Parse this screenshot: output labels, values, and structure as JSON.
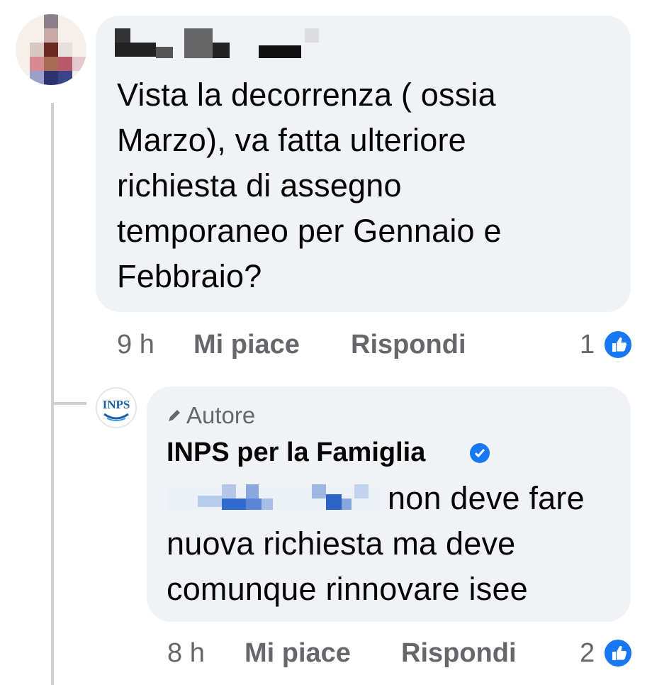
{
  "comment": {
    "text": "Vista la decorrenza ( ossia Marzo), va fatta ulteriore richiesta di assegno temporaneo per Gennaio e Febbraio?",
    "lines": [
      "Vista la decorrenza ( ossia",
      "Marzo), va fatta ulteriore",
      "richiesta di assegno",
      "temporaneo per Gennaio e",
      "Febbraio?"
    ],
    "time": "9 h",
    "like_label": "Mi piace",
    "reply_label": "Rispondi",
    "reaction_count": "1"
  },
  "reply": {
    "author_tag": "Autore",
    "page_name": "INPS per la Famiglia",
    "avatar_text": "INPS",
    "lines": [
      "non deve fare",
      "nuova richiesta ma deve",
      "comunque rinnovare isee"
    ],
    "time": "8 h",
    "like_label": "Mi piace",
    "reply_label": "Rispondi",
    "reaction_count": "2"
  },
  "colors": {
    "bubble": "#f0f2f5",
    "meta_text": "#65676b",
    "accent": "#1877f2"
  }
}
